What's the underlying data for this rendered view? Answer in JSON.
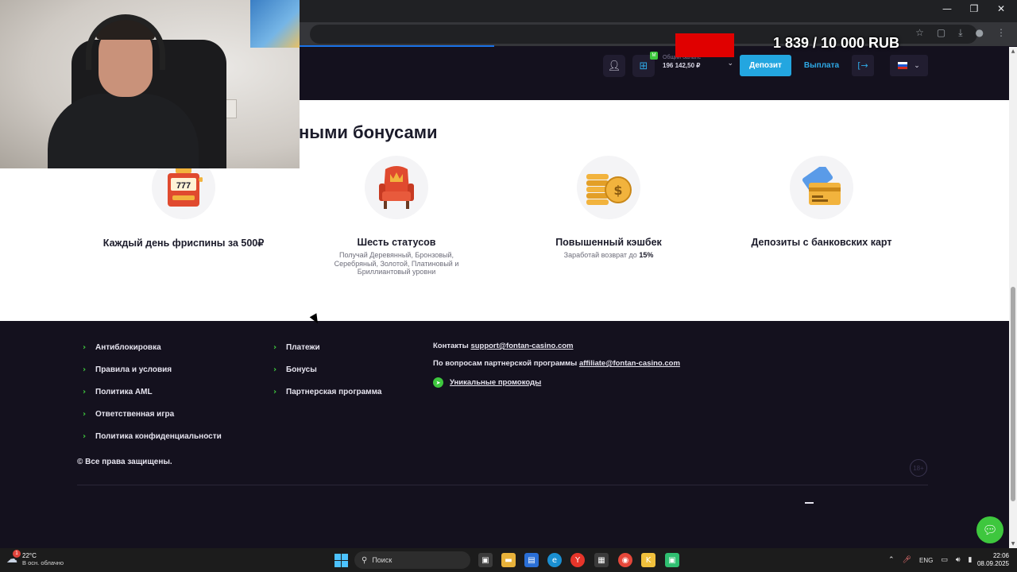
{
  "browser": {
    "window_controls": [
      "—",
      "❐",
      "✕"
    ],
    "toolbar_icons": [
      "star-icon",
      "extensions-icon",
      "download-icon",
      "profile-icon",
      "menu-icon"
    ]
  },
  "overlay": {
    "goal_text": "1 839 / 10 000 RUB"
  },
  "header": {
    "balance_label": "Общий баланс",
    "balance_value": "196 142,50 ₽",
    "deposit_label": "Депозит",
    "withdraw_label": "Выплата",
    "logout_glyph": "[→",
    "badge_text": "M"
  },
  "promo": {
    "title": "ными бонусами",
    "features": [
      {
        "icon": "slot-machine-icon",
        "title": "Каждый день фриспины за 500₽",
        "desc": ""
      },
      {
        "icon": "throne-icon",
        "title": "Шесть статусов",
        "desc": "Получай Деревянный, Бронзовый, Серебряный, Золотой, Платиновый и Бриллиантовый уровни"
      },
      {
        "icon": "coins-icon",
        "title": "Повышенный кэшбек",
        "desc_prefix": "Заработай возврат до ",
        "desc_strong": "15%"
      },
      {
        "icon": "bank-card-icon",
        "title": "Депозиты с банковских карт",
        "desc": ""
      }
    ]
  },
  "footer": {
    "col1": [
      "Антиблокировка",
      "Правила и условия",
      "Политика AML",
      "Ответственная игра",
      "Политика конфиденциальности"
    ],
    "col2": [
      "Платежи",
      "Бонусы",
      "Партнерская программа"
    ],
    "contacts_label": "Контакты",
    "contacts_email": "support@fontan-casino.com",
    "affiliate_label": "По вопросам партнерской программы",
    "affiliate_email": "affiliate@fontan-casino.com",
    "promo_codes_label": "Уникальные промокоды",
    "rights": "© Все права защищены.",
    "age_badge": "18+"
  },
  "taskbar": {
    "weather_temp": "22°C",
    "weather_desc": "В осн. облачно",
    "weather_badge": "1",
    "search_placeholder": "Поиск",
    "language": "ENG",
    "time": "22:06",
    "date": "08.09.2025"
  }
}
